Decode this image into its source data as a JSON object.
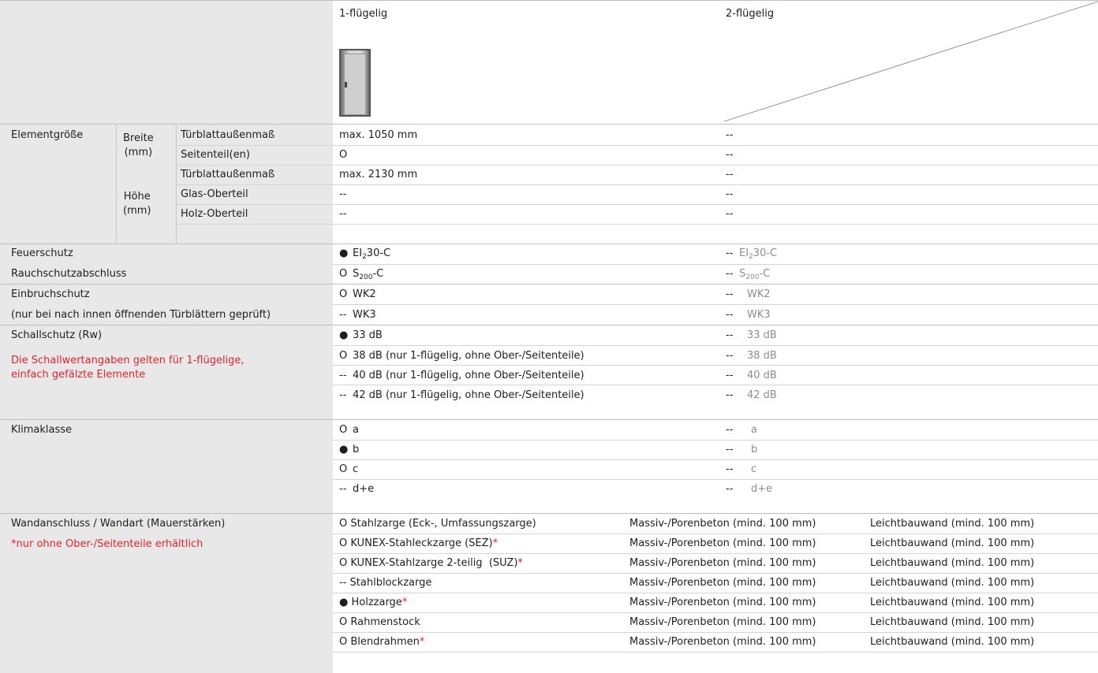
{
  "header": {
    "col1": "1-flügelig",
    "col2": "2-flügelig",
    "door_icon": "door-1-wing-image"
  },
  "size": {
    "group": "Elementgröße",
    "breite": "Breite\n(mm)",
    "hoehe": "Höhe\n(mm)",
    "rows": [
      {
        "label": "Türblattaußenmaß",
        "v1": "max. 1050 mm",
        "v2": "--"
      },
      {
        "label": "Seitenteil(en)",
        "v1": "O",
        "v2": "--"
      },
      {
        "label": "Türblattaußenmaß",
        "v1": "max. 2130 mm",
        "v2": "--"
      },
      {
        "label": "Glas-Oberteil",
        "v1": "--",
        "v2": "--"
      },
      {
        "label": "Holz-Oberteil",
        "v1": "--",
        "v2": "--"
      }
    ]
  },
  "fire": {
    "label1": "Feuerschutz",
    "label2": "Rauchschutzabschluss",
    "r1_sym": "●",
    "r1_pre": "EI",
    "r1_sub": "2",
    "r1_post": "30-C",
    "r2_sym": "O",
    "r2_pre": "S",
    "r2_sub": "200",
    "r2_post": "-C",
    "c2_sym": "--"
  },
  "burglary": {
    "label1": "Einbruchschutz",
    "label2": "(nur bei nach innen öffnenden Türblättern geprüft)",
    "rows": [
      {
        "sym1": "O",
        "v": "WK2",
        "sym2": "--"
      },
      {
        "sym1": "--",
        "v": "WK3",
        "sym2": "--"
      }
    ]
  },
  "sound": {
    "label": "Schallschutz (Rw)",
    "note": "Die Schallwertangaben gelten für 1-flügelige,\neinfach gefälzte Elemente",
    "rows": [
      {
        "sym1": "●",
        "v1": "33 dB",
        "sym2": "--",
        "v2": "33 dB"
      },
      {
        "sym1": "O",
        "v1": "38 dB (nur 1-flügelig, ohne Ober-/Seitenteile)",
        "sym2": "--",
        "v2": "38 dB"
      },
      {
        "sym1": "--",
        "v1": "40 dB (nur 1-flügelig, ohne Ober-/Seitenteile)",
        "sym2": "--",
        "v2": "40 dB"
      },
      {
        "sym1": "--",
        "v1": "42 dB (nur 1-flügelig, ohne Ober-/Seitenteile)",
        "sym2": "--",
        "v2": "42 dB"
      }
    ]
  },
  "climate": {
    "label": "Klimaklasse",
    "rows": [
      {
        "sym1": "O",
        "v": "a",
        "sym2": "--"
      },
      {
        "sym1": "●",
        "v": "b",
        "sym2": "--"
      },
      {
        "sym1": "O",
        "v": "c",
        "sym2": "--"
      },
      {
        "sym1": "--",
        "v": "d+e",
        "sym2": "--"
      }
    ]
  },
  "wall": {
    "label": "Wandanschluss / Wandart (Mauerstärken)",
    "note": "*nur ohne Ober-/Seitenteile erhältlich",
    "rows": [
      {
        "sym": "O",
        "name": "Stahlzarge (Eck-, Umfassungszarge)",
        "star": "",
        "massiv": "Massiv-/Porenbeton (mind. 100 mm)",
        "leicht": "Leichtbauwand (mind. 100 mm)"
      },
      {
        "sym": "O",
        "name": "KUNEX-Stahleckzarge (SEZ)",
        "star": "*",
        "massiv": "Massiv-/Porenbeton (mind. 100 mm)",
        "leicht": "Leichtbauwand (mind. 100 mm)"
      },
      {
        "sym": "O",
        "name": "KUNEX-Stahlzarge 2-teilig  (SUZ)",
        "star": "*",
        "massiv": "Massiv-/Porenbeton (mind. 100 mm)",
        "leicht": "Leichtbauwand (mind. 100 mm)"
      },
      {
        "sym": "--",
        "name": "Stahlblockzarge",
        "star": "",
        "massiv": "Massiv-/Porenbeton (mind. 100 mm)",
        "leicht": "Leichtbauwand (mind. 100 mm)"
      },
      {
        "sym": "●",
        "name": "Holzzarge",
        "star": "*",
        "massiv": "Massiv-/Porenbeton (mind. 100 mm)",
        "leicht": "Leichtbauwand (mind. 100 mm)"
      },
      {
        "sym": "O",
        "name": "Rahmenstock",
        "star": "",
        "massiv": "Massiv-/Porenbeton (mind. 100 mm)",
        "leicht": "Leichtbauwand (mind. 100 mm)"
      },
      {
        "sym": "O",
        "name": "Blendrahmen",
        "star": "*",
        "massiv": "Massiv-/Porenbeton (mind. 100 mm)",
        "leicht": "Leichtbauwand (mind. 100 mm)"
      }
    ]
  }
}
